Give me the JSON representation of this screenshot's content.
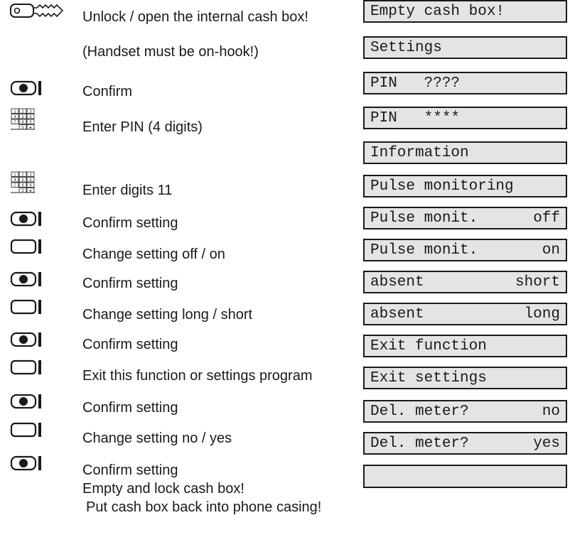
{
  "steps": [
    {
      "icon": "key-icon",
      "text": "Unlock / open the internal cash box!"
    },
    {
      "icon": "",
      "text": "(Handset must be on-hook!)"
    },
    {
      "icon": "confirm-key-icon",
      "text": "Confirm"
    },
    {
      "icon": "keypad-icon",
      "text": "Enter PIN (4 digits)"
    },
    {
      "icon": "keypad-icon",
      "text": "Enter digits 11"
    },
    {
      "icon": "confirm-key-icon",
      "text": "Confirm setting"
    },
    {
      "icon": "blank-key-icon",
      "text": "Change setting off / on"
    },
    {
      "icon": "confirm-key-icon",
      "text": "Confirm setting"
    },
    {
      "icon": "blank-key-icon",
      "text": "Change setting long / short"
    },
    {
      "icon": "confirm-key-icon",
      "text": "Confirm setting"
    },
    {
      "icon": "blank-key-icon",
      "text": "Exit this function or settings program"
    },
    {
      "icon": "confirm-key-icon",
      "text": "Confirm setting"
    },
    {
      "icon": "blank-key-icon",
      "text": "Change setting no / yes"
    },
    {
      "icon": "confirm-key-icon",
      "text": "Confirm setting"
    }
  ],
  "closing_lines": [
    "Empty and lock cash box!",
    "Put cash box back into phone casing!"
  ],
  "displays": [
    {
      "text": "Empty cash box!"
    },
    {
      "text": "Settings"
    },
    {
      "text": "PIN   ????"
    },
    {
      "text": "PIN   ****"
    },
    {
      "text": "Information"
    },
    {
      "text": "Pulse monitoring"
    },
    {
      "left": "Pulse monit.",
      "right": "off"
    },
    {
      "left": "Pulse monit.",
      "right": "on"
    },
    {
      "left": "absent",
      "right": "short"
    },
    {
      "left": "absent",
      "right": "long"
    },
    {
      "text": "Exit function"
    },
    {
      "text": "Exit settings"
    },
    {
      "left": "Del. meter?",
      "right": "no"
    },
    {
      "left": "Del. meter?",
      "right": "yes"
    },
    {
      "text": ""
    }
  ],
  "keypad_digits": [
    "1",
    "2",
    "3",
    "4",
    "5",
    "6",
    "7",
    "8",
    "9",
    "0",
    "●"
  ],
  "colors": {
    "display_bg": "#e4e4e4",
    "ink": "#1a1a1a"
  }
}
